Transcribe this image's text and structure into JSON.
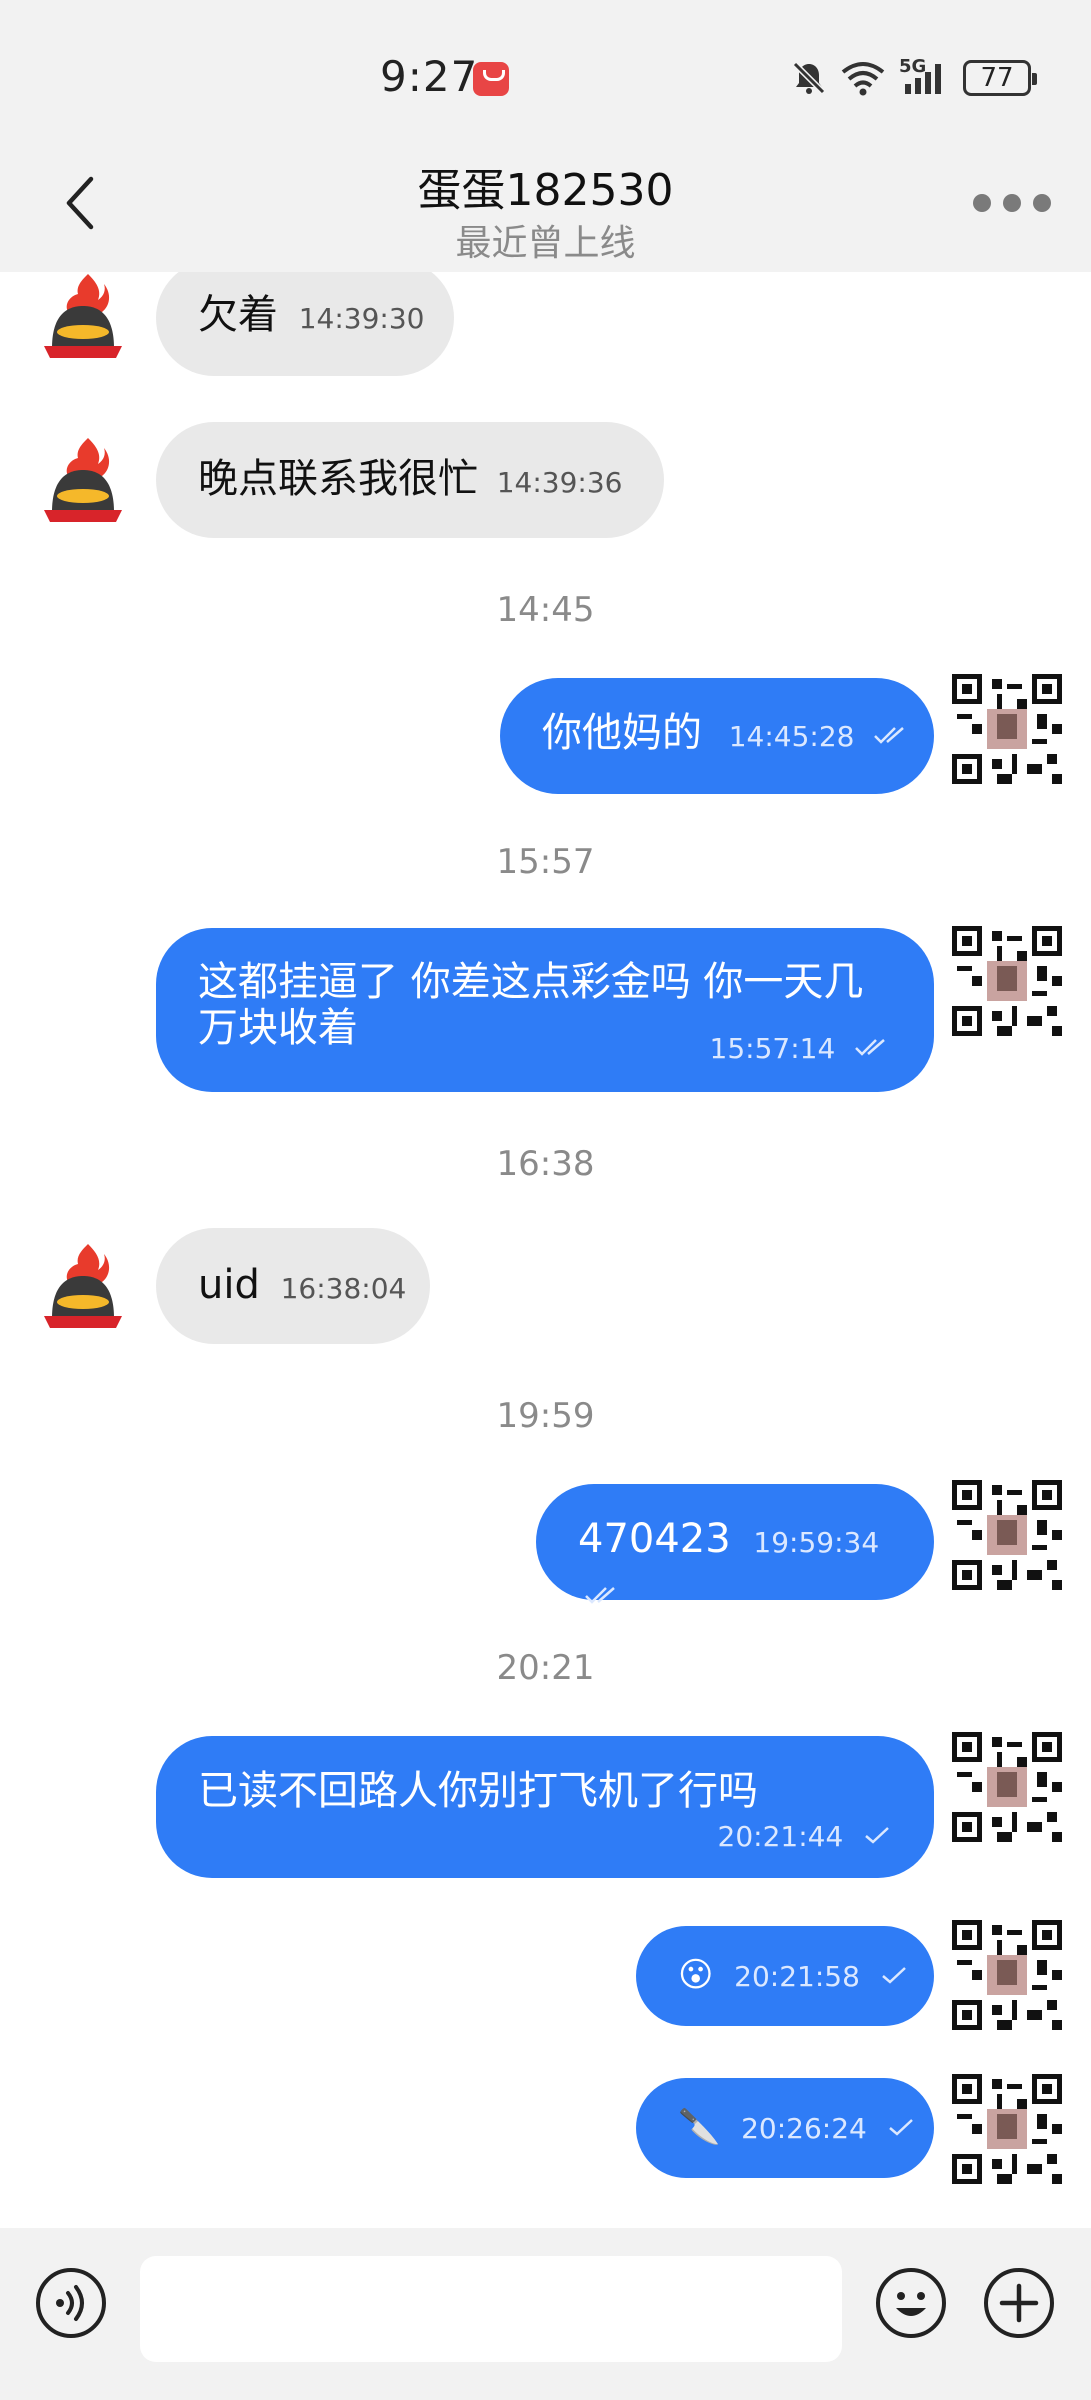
{
  "status_bar": {
    "time": "9:27",
    "network": "5G",
    "battery": "77"
  },
  "header": {
    "contact_name": "蛋蛋182530",
    "contact_status": "最近曾上线"
  },
  "messages": [
    {
      "direction": "in",
      "text": "欠着",
      "time": "14:39:30"
    },
    {
      "direction": "in",
      "text": "晚点联系我很忙",
      "time": "14:39:36"
    },
    {
      "separator": "14:45"
    },
    {
      "direction": "out",
      "text": "你他妈的",
      "time": "14:45:28",
      "status": "read"
    },
    {
      "separator": "15:57"
    },
    {
      "direction": "out",
      "text_line1": "这都挂逼了 你差这点彩金吗 你一天几",
      "text_line2": "万块收着",
      "time": "15:57:14",
      "status": "read"
    },
    {
      "separator": "16:38"
    },
    {
      "direction": "in",
      "text": "uid",
      "time": "16:38:04"
    },
    {
      "separator": "19:59"
    },
    {
      "direction": "out",
      "text": "470423",
      "time": "19:59:34",
      "status": "read"
    },
    {
      "separator": "20:21"
    },
    {
      "direction": "out",
      "text": "已读不回路人你别打飞机了行吗",
      "time": "20:21:44",
      "status": "sent"
    },
    {
      "direction": "out",
      "emoji": "😮",
      "time": "20:21:58",
      "status": "sent"
    },
    {
      "direction": "out",
      "emoji": "🔪",
      "time": "20:26:24",
      "status": "sent"
    }
  ],
  "input": {
    "placeholder": ""
  },
  "colors": {
    "outgoing_bubble": "#2f7cf6",
    "incoming_bubble": "#e9e9e9",
    "bar_background": "#f2f2f2"
  },
  "icons": {
    "back": "chevron-left-icon",
    "more": "more-dots-icon",
    "voice": "voice-icon",
    "emoji": "smiley-icon",
    "add": "plus-circle-icon"
  }
}
